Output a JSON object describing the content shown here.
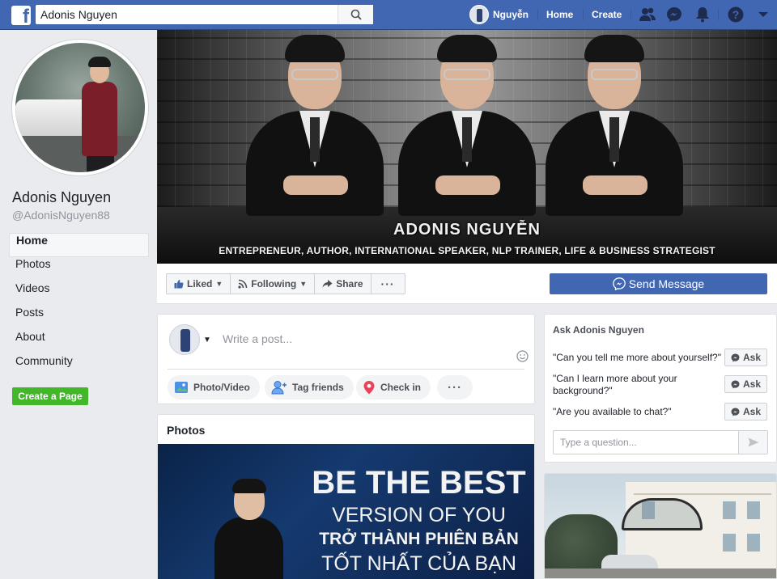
{
  "topbar": {
    "search_value": "Adonis Nguyen",
    "user_name": "Nguyễn",
    "home_label": "Home",
    "create_label": "Create"
  },
  "profile": {
    "name": "Adonis Nguyen",
    "handle": "@AdonisNguyen88"
  },
  "left_nav": {
    "items": [
      {
        "label": "Home",
        "active": true
      },
      {
        "label": "Photos"
      },
      {
        "label": "Videos"
      },
      {
        "label": "Posts"
      },
      {
        "label": "About"
      },
      {
        "label": "Community"
      }
    ],
    "create_page_label": "Create a Page"
  },
  "cover": {
    "title": "ADONIS NGUYỄN",
    "subtitle": "ENTREPRENEUR, AUTHOR, INTERNATIONAL SPEAKER, NLP TRAINER, LIFE & BUSINESS STRATEGIST"
  },
  "actions": {
    "liked_label": "Liked",
    "following_label": "Following",
    "share_label": "Share",
    "more_label": "···",
    "send_message_label": "Send Message"
  },
  "composer": {
    "placeholder": "Write a post...",
    "photo_video_label": "Photo/Video",
    "tag_friends_label": "Tag friends",
    "check_in_label": "Check in",
    "more_label": "···"
  },
  "photos": {
    "title": "Photos",
    "banner_lines": [
      "BE THE BEST",
      "VERSION OF YOU",
      "TRỞ THÀNH PHIÊN BẢN",
      "TỐT NHẤT CỦA BẠN"
    ]
  },
  "ask": {
    "title": "Ask Adonis Nguyen",
    "questions": [
      {
        "text": "\"Can you tell me more about yourself?\"",
        "button": "Ask"
      },
      {
        "text": "\"Can I learn more about your background?\"",
        "button": "Ask"
      },
      {
        "text": "\"Are you available to chat?\"",
        "button": "Ask"
      }
    ],
    "input_placeholder": "Type a question..."
  },
  "colors": {
    "brand_blue": "#4267b2",
    "create_green": "#42b72a",
    "background": "#e9ebee"
  }
}
